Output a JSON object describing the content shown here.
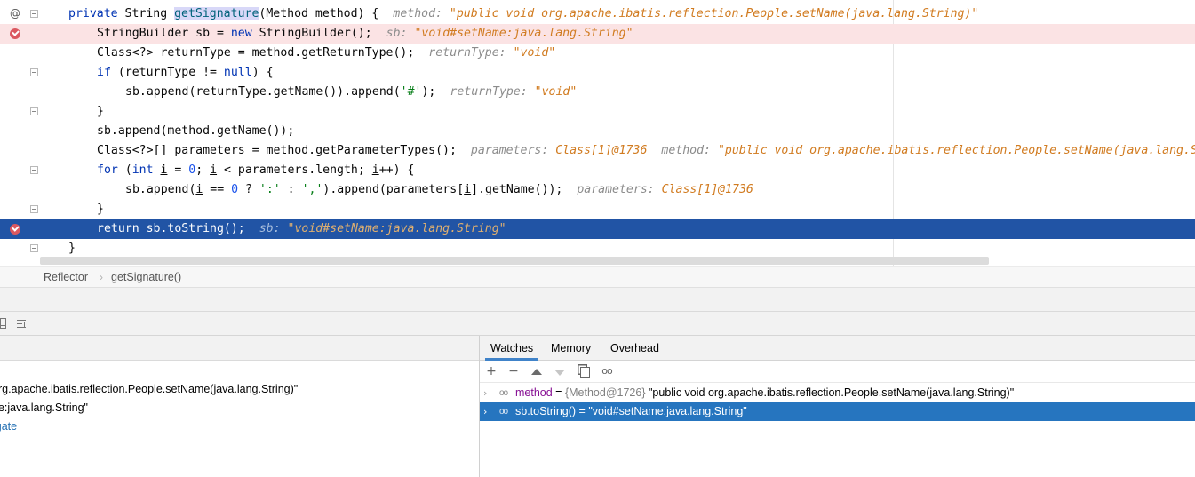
{
  "colors": {
    "breakpoint": "#db5860",
    "execution_line": "#2154a5",
    "breakpoint_line": "#fbe3e4",
    "keyword": "#0033b3",
    "hint_value": "#d17b20",
    "selection": "#2675bf",
    "tab_underline": "#4083c9"
  },
  "editor": {
    "lines": [
      {
        "parts": [
          {
            "t": "private ",
            "c": "kw"
          },
          {
            "t": "String "
          },
          {
            "t": "getSignature",
            "c": "hl-name"
          },
          {
            "t": "(Method method) {"
          },
          {
            "t": "method: ",
            "c": "hint-k"
          },
          {
            "t": "\"public void org.apache.ibatis.reflection.People.setName(java.lang.String)\"",
            "c": "hint-v"
          }
        ]
      },
      {
        "parts": [
          {
            "t": "StringBuilder sb = "
          },
          {
            "t": "new ",
            "c": "kw"
          },
          {
            "t": "StringBuilder();"
          },
          {
            "t": "sb: ",
            "c": "hint-k"
          },
          {
            "t": "\"void#setName:java.lang.String\"",
            "c": "hint-v"
          }
        ]
      },
      {
        "parts": [
          {
            "t": "Class<?> returnType = method.getReturnType();"
          },
          {
            "t": "returnType: ",
            "c": "hint-k"
          },
          {
            "t": "\"void\"",
            "c": "hint-v"
          }
        ]
      },
      {
        "parts": [
          {
            "t": "if ",
            "c": "kw"
          },
          {
            "t": "(returnType != "
          },
          {
            "t": "null",
            "c": "kw"
          },
          {
            "t": ") {"
          }
        ]
      },
      {
        "parts": [
          {
            "t": "sb.append(returnType.getName()).append("
          },
          {
            "t": "'#'",
            "c": "str"
          },
          {
            "t": ");"
          },
          {
            "t": "returnType: ",
            "c": "hint-k"
          },
          {
            "t": "\"void\"",
            "c": "hint-v"
          }
        ]
      },
      {
        "parts": [
          {
            "t": "}"
          }
        ]
      },
      {
        "parts": [
          {
            "t": "sb.append(method.getName());"
          }
        ]
      },
      {
        "parts": [
          {
            "t": "Class<?>[] parameters = method.getParameterTypes();"
          },
          {
            "t": "parameters: ",
            "c": "hint-k"
          },
          {
            "t": "Class[1]@1736",
            "c": "hint-v"
          },
          {
            "t": "method: ",
            "c": "hint-k"
          },
          {
            "t": "\"public void org.apache.ibatis.reflection.People.setName(java.lang.String)\"",
            "c": "hint-v"
          }
        ]
      },
      {
        "parts": [
          {
            "t": "for ",
            "c": "kw"
          },
          {
            "t": "("
          },
          {
            "t": "int ",
            "c": "kw"
          },
          {
            "t": "i",
            "c": "ul"
          },
          {
            "t": " = "
          },
          {
            "t": "0",
            "c": "num"
          },
          {
            "t": "; "
          },
          {
            "t": "i",
            "c": "ul"
          },
          {
            "t": " < parameters.length; "
          },
          {
            "t": "i",
            "c": "ul"
          },
          {
            "t": "++) {"
          }
        ]
      },
      {
        "parts": [
          {
            "t": "sb.append("
          },
          {
            "t": "i",
            "c": "ul"
          },
          {
            "t": " == "
          },
          {
            "t": "0",
            "c": "num"
          },
          {
            "t": " ? "
          },
          {
            "t": "':'",
            "c": "str"
          },
          {
            "t": " : "
          },
          {
            "t": "','",
            "c": "str"
          },
          {
            "t": ").append(parameters["
          },
          {
            "t": "i",
            "c": "ul"
          },
          {
            "t": "].getName());"
          },
          {
            "t": "parameters: ",
            "c": "hint-k"
          },
          {
            "t": "Class[1]@1736",
            "c": "hint-v"
          }
        ]
      },
      {
        "parts": [
          {
            "t": "}"
          }
        ]
      },
      {
        "parts": [
          {
            "t": "return sb.toString();"
          },
          {
            "t": "sb: ",
            "c": "hint-k"
          },
          {
            "t": "\"void#setName:java.lang.String\"",
            "c": "hint-v"
          }
        ]
      },
      {
        "parts": [
          {
            "t": "}"
          }
        ]
      }
    ]
  },
  "breadcrumb": {
    "class_name": "Reflector",
    "separator": "›",
    "method_name": "getSignature()"
  },
  "variables": {
    "line1": "org.apache.ibatis.reflection.People.setName(java.lang.String)\"",
    "line2": "ne:java.lang.String\"",
    "line3": "igate"
  },
  "watches_panel": {
    "tabs": [
      "Watches",
      "Memory",
      "Overhead"
    ],
    "toolbar_icons": [
      "add-icon",
      "remove-icon",
      "move-up-icon",
      "move-down-icon",
      "duplicate-icon",
      "glasses-icon"
    ],
    "rows": [
      {
        "chevron": "›",
        "name": "method",
        "equals": " = ",
        "type": "{Method@1726}",
        "value": " \"public void org.apache.ibatis.reflection.People.setName(java.lang.String)\""
      },
      {
        "chevron": "›",
        "expr": "sb.toString() = \"void#setName:java.lang.String\""
      }
    ]
  }
}
